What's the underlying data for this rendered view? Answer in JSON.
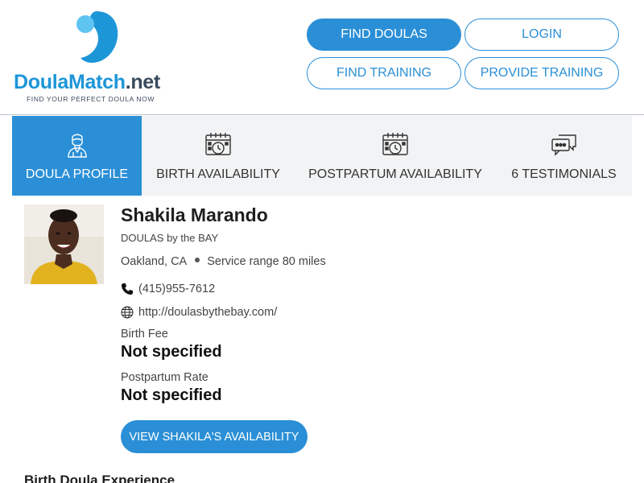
{
  "header": {
    "logo": {
      "name_part1": "Doula",
      "name_part2": "Match",
      "name_part3": ".net",
      "tagline": "FIND YOUR PERFECT DOULA NOW"
    },
    "nav": {
      "find_doulas": "FIND DOULAS",
      "login": "LOGIN",
      "find_training": "FIND TRAINING",
      "provide_training": "PROVIDE TRAINING"
    }
  },
  "tabs": [
    {
      "label": "DOULA PROFILE",
      "icon": "doula-person-icon",
      "active": true
    },
    {
      "label": "BIRTH AVAILABILITY",
      "icon": "calendar-clock-icon",
      "active": false
    },
    {
      "label": "POSTPARTUM AVAILABILITY",
      "icon": "calendar-clock-icon",
      "active": false
    },
    {
      "label": "6 TESTIMONIALS",
      "icon": "chat-bubbles-icon",
      "active": false
    }
  ],
  "profile": {
    "name": "Shakila Marando",
    "agency": "DOULAS by the BAY",
    "location": "Oakland, CA",
    "service_range": "Service range 80 miles",
    "phone": "(415)955-7612",
    "website": "http://doulasbythebay.com/",
    "birth_fee_label": "Birth Fee",
    "birth_fee_value": "Not specified",
    "postpartum_rate_label": "Postpartum Rate",
    "postpartum_rate_value": "Not specified",
    "availability_button": "VIEW SHAKILA'S AVAILABILITY"
  },
  "sections": {
    "experience_heading": "Birth Doula Experience"
  },
  "colors": {
    "brand_blue": "#2a8fd6",
    "logo_blue": "#1d96d8",
    "logo_light_blue": "#5ec4f2",
    "tab_bg": "#f2f3f4",
    "dark_text": "#1e1e1e"
  }
}
